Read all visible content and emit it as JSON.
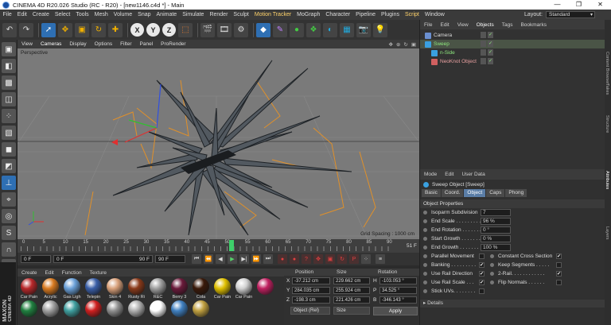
{
  "window": {
    "title": "CINEMA 4D R20.026 Studio (RC - R20) - [new1146.c4d *] - Main",
    "minimize": "—",
    "maximize": "❐",
    "close": "✕"
  },
  "menu": {
    "items": [
      "File",
      "Edit",
      "Create",
      "Select",
      "Tools",
      "Mesh",
      "Volume",
      "Snap",
      "Animate",
      "Simulate",
      "Render",
      "Sculpt",
      "Motion Tracker",
      "MoGraph",
      "Character",
      "Pipeline",
      "Plugins",
      "Script",
      "Window"
    ],
    "layout_label": "Layout:",
    "layout_value": "Standard"
  },
  "toolbar": {
    "axis_x": "X",
    "axis_y": "Y",
    "axis_z": "Z"
  },
  "viewport": {
    "menu": [
      "View",
      "Cameras",
      "Display",
      "Options",
      "Filter",
      "Panel",
      "ProRender"
    ],
    "label": "Perspective",
    "grid_spacing": "Grid Spacing : 1000 cm"
  },
  "timeline": {
    "ticks": [
      "0",
      "5",
      "10",
      "15",
      "20",
      "25",
      "30",
      "35",
      "40",
      "45",
      "50",
      "55",
      "60",
      "65",
      "70",
      "75",
      "80",
      "85",
      "90"
    ],
    "end_frame": "51 F",
    "current": "51",
    "current_frame": 51,
    "min_frame": 0,
    "max_frame": 90
  },
  "transport": {
    "start": "0 F",
    "start2": "0 F",
    "end": "90 F",
    "end2": "90 F"
  },
  "materials": {
    "menu": [
      "Create",
      "Edit",
      "Function",
      "Texture"
    ],
    "row1": [
      {
        "name": "Car Pain",
        "color": "#b8282a"
      },
      {
        "name": "Acrylic",
        "color": "#d87a20"
      },
      {
        "name": "Gas Ligh",
        "color": "#6aa0d8"
      },
      {
        "name": "Telepin",
        "color": "#3a5fa8"
      },
      {
        "name": "Skin 4",
        "color": "#d8a07a"
      },
      {
        "name": "Rusty Ri",
        "color": "#8a3a1a"
      },
      {
        "name": "R&C",
        "color": "#a0a0a0"
      },
      {
        "name": "Berry 3",
        "color": "#6a1a3a"
      },
      {
        "name": "Cola",
        "color": "#3a1a0a"
      },
      {
        "name": "Car Pain",
        "color": "#e0c000"
      },
      {
        "name": "Car Pain",
        "color": "#d0d0d0"
      }
    ],
    "row2": [
      {
        "name": "",
        "color": "#c02060"
      },
      {
        "name": "",
        "color": "#208040"
      },
      {
        "name": "",
        "color": "#a0a0a0"
      },
      {
        "name": "",
        "color": "#40a0a0"
      },
      {
        "name": "",
        "color": "#d02020"
      },
      {
        "name": "",
        "color": "#909090"
      },
      {
        "name": "",
        "color": "#b0b0b0"
      },
      {
        "name": "",
        "color": "#ffffff"
      },
      {
        "name": "",
        "color": "#4080c0"
      },
      {
        "name": "",
        "color": "#c0a040"
      }
    ]
  },
  "coords": {
    "headers": [
      "Position",
      "Size",
      "Rotation"
    ],
    "rows": [
      {
        "axis": "X",
        "pos": "-37.212 cm",
        "size": "229.662 cm",
        "rot_axis": "H",
        "rot": "-103.053 °"
      },
      {
        "axis": "Y",
        "pos": "284.035 cm",
        "size": "255.924 cm",
        "rot_axis": "P",
        "rot": "34.525 °"
      },
      {
        "axis": "Z",
        "pos": "-198.3 cm",
        "size": "221.426 cm",
        "rot_axis": "B",
        "rot": "-346.143 °"
      }
    ],
    "mode1": "Object (Rel)",
    "mode2": "Size",
    "apply": "Apply"
  },
  "objects": {
    "menu": [
      "File",
      "Edit",
      "View",
      "Objects",
      "Tags",
      "Bookmarks"
    ],
    "items": [
      {
        "name": "Camera",
        "indent": 0,
        "color": "#ddd",
        "icon": "#6a8fd0",
        "sel": false
      },
      {
        "name": "Sweep",
        "indent": 0,
        "color": "#8ee87e",
        "icon": "#3aa0e0",
        "sel": true
      },
      {
        "name": "n-Side",
        "indent": 1,
        "color": "#8ee87e",
        "icon": "#3aa0e0",
        "sel": false
      },
      {
        "name": "NeoKnot Object",
        "indent": 1,
        "color": "#e8a0a0",
        "icon": "#d06060",
        "sel": false
      }
    ]
  },
  "attributes": {
    "menu": [
      "Mode",
      "Edit",
      "User Data"
    ],
    "title": "Sweep Object [Sweep]",
    "tabs": [
      "Basic",
      "Coord.",
      "Object",
      "Caps",
      "Phong"
    ],
    "section": "Object Properties",
    "fields": [
      {
        "label": "Isoparm Subdivision",
        "value": "7"
      },
      {
        "label": "End Scale . . . . . . . . .",
        "value": "96 %"
      },
      {
        "label": "End Rotation . . . . . . .",
        "value": "0 °"
      },
      {
        "label": "Start Growth . . . . . . .",
        "value": "0 %"
      },
      {
        "label": "End Growth . . . . . . . .",
        "value": "100 %"
      }
    ],
    "checks_left": [
      {
        "label": "Parallel Movement",
        "checked": ""
      },
      {
        "label": "Banking . . . . . . . . .",
        "checked": "✔"
      },
      {
        "label": "Use Rail Direction",
        "checked": "✔"
      },
      {
        "label": "Use Rail Scale . . .",
        "checked": "✔"
      },
      {
        "label": "Stick UVs. . . . . . . .",
        "checked": ""
      }
    ],
    "checks_right": [
      {
        "label": "Constant Cross Section",
        "checked": "✔"
      },
      {
        "label": "Keep Segments . . . . .",
        "checked": ""
      },
      {
        "label": "2-Rail. . . . . . . . . . . .",
        "checked": "✔"
      },
      {
        "label": "Flip Normals . . . . . .",
        "checked": ""
      }
    ],
    "details": "Details"
  },
  "sidetabs": [
    "Content Browser",
    "Takes",
    "Structure",
    "Attributes",
    "Layers"
  ],
  "logo": {
    "line1": "MAXON",
    "line2": "CINEMA 4D"
  }
}
